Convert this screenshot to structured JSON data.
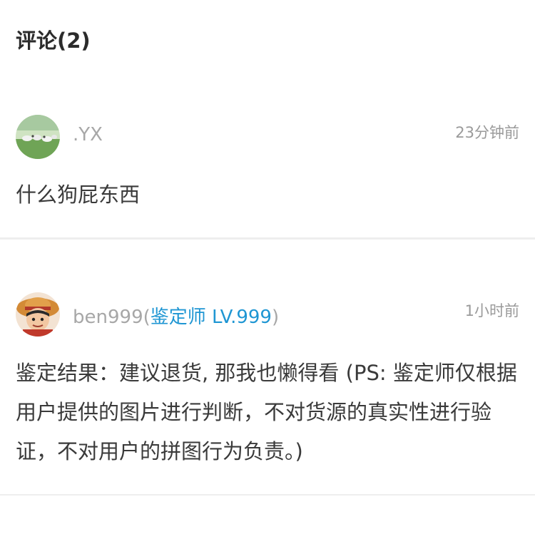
{
  "comments_header": {
    "title": "评论(2)"
  },
  "comments": [
    {
      "username": ".YX",
      "time": "23分钟前",
      "text": "什么狗屁东西"
    },
    {
      "username_prefix": "ben999(",
      "role": "鉴定师 LV.999",
      "username_suffix": ")",
      "time": "1小时前",
      "text": "鉴定结果：建议退货, 那我也懒得看 (PS: 鉴定师仅根据用户提供的图片进行判断，不对货源的真实性进行验证，不对用户的拼图行为负责。)"
    }
  ],
  "colors": {
    "role_accent": "#1f96d3",
    "muted": "#a7a7a7"
  }
}
